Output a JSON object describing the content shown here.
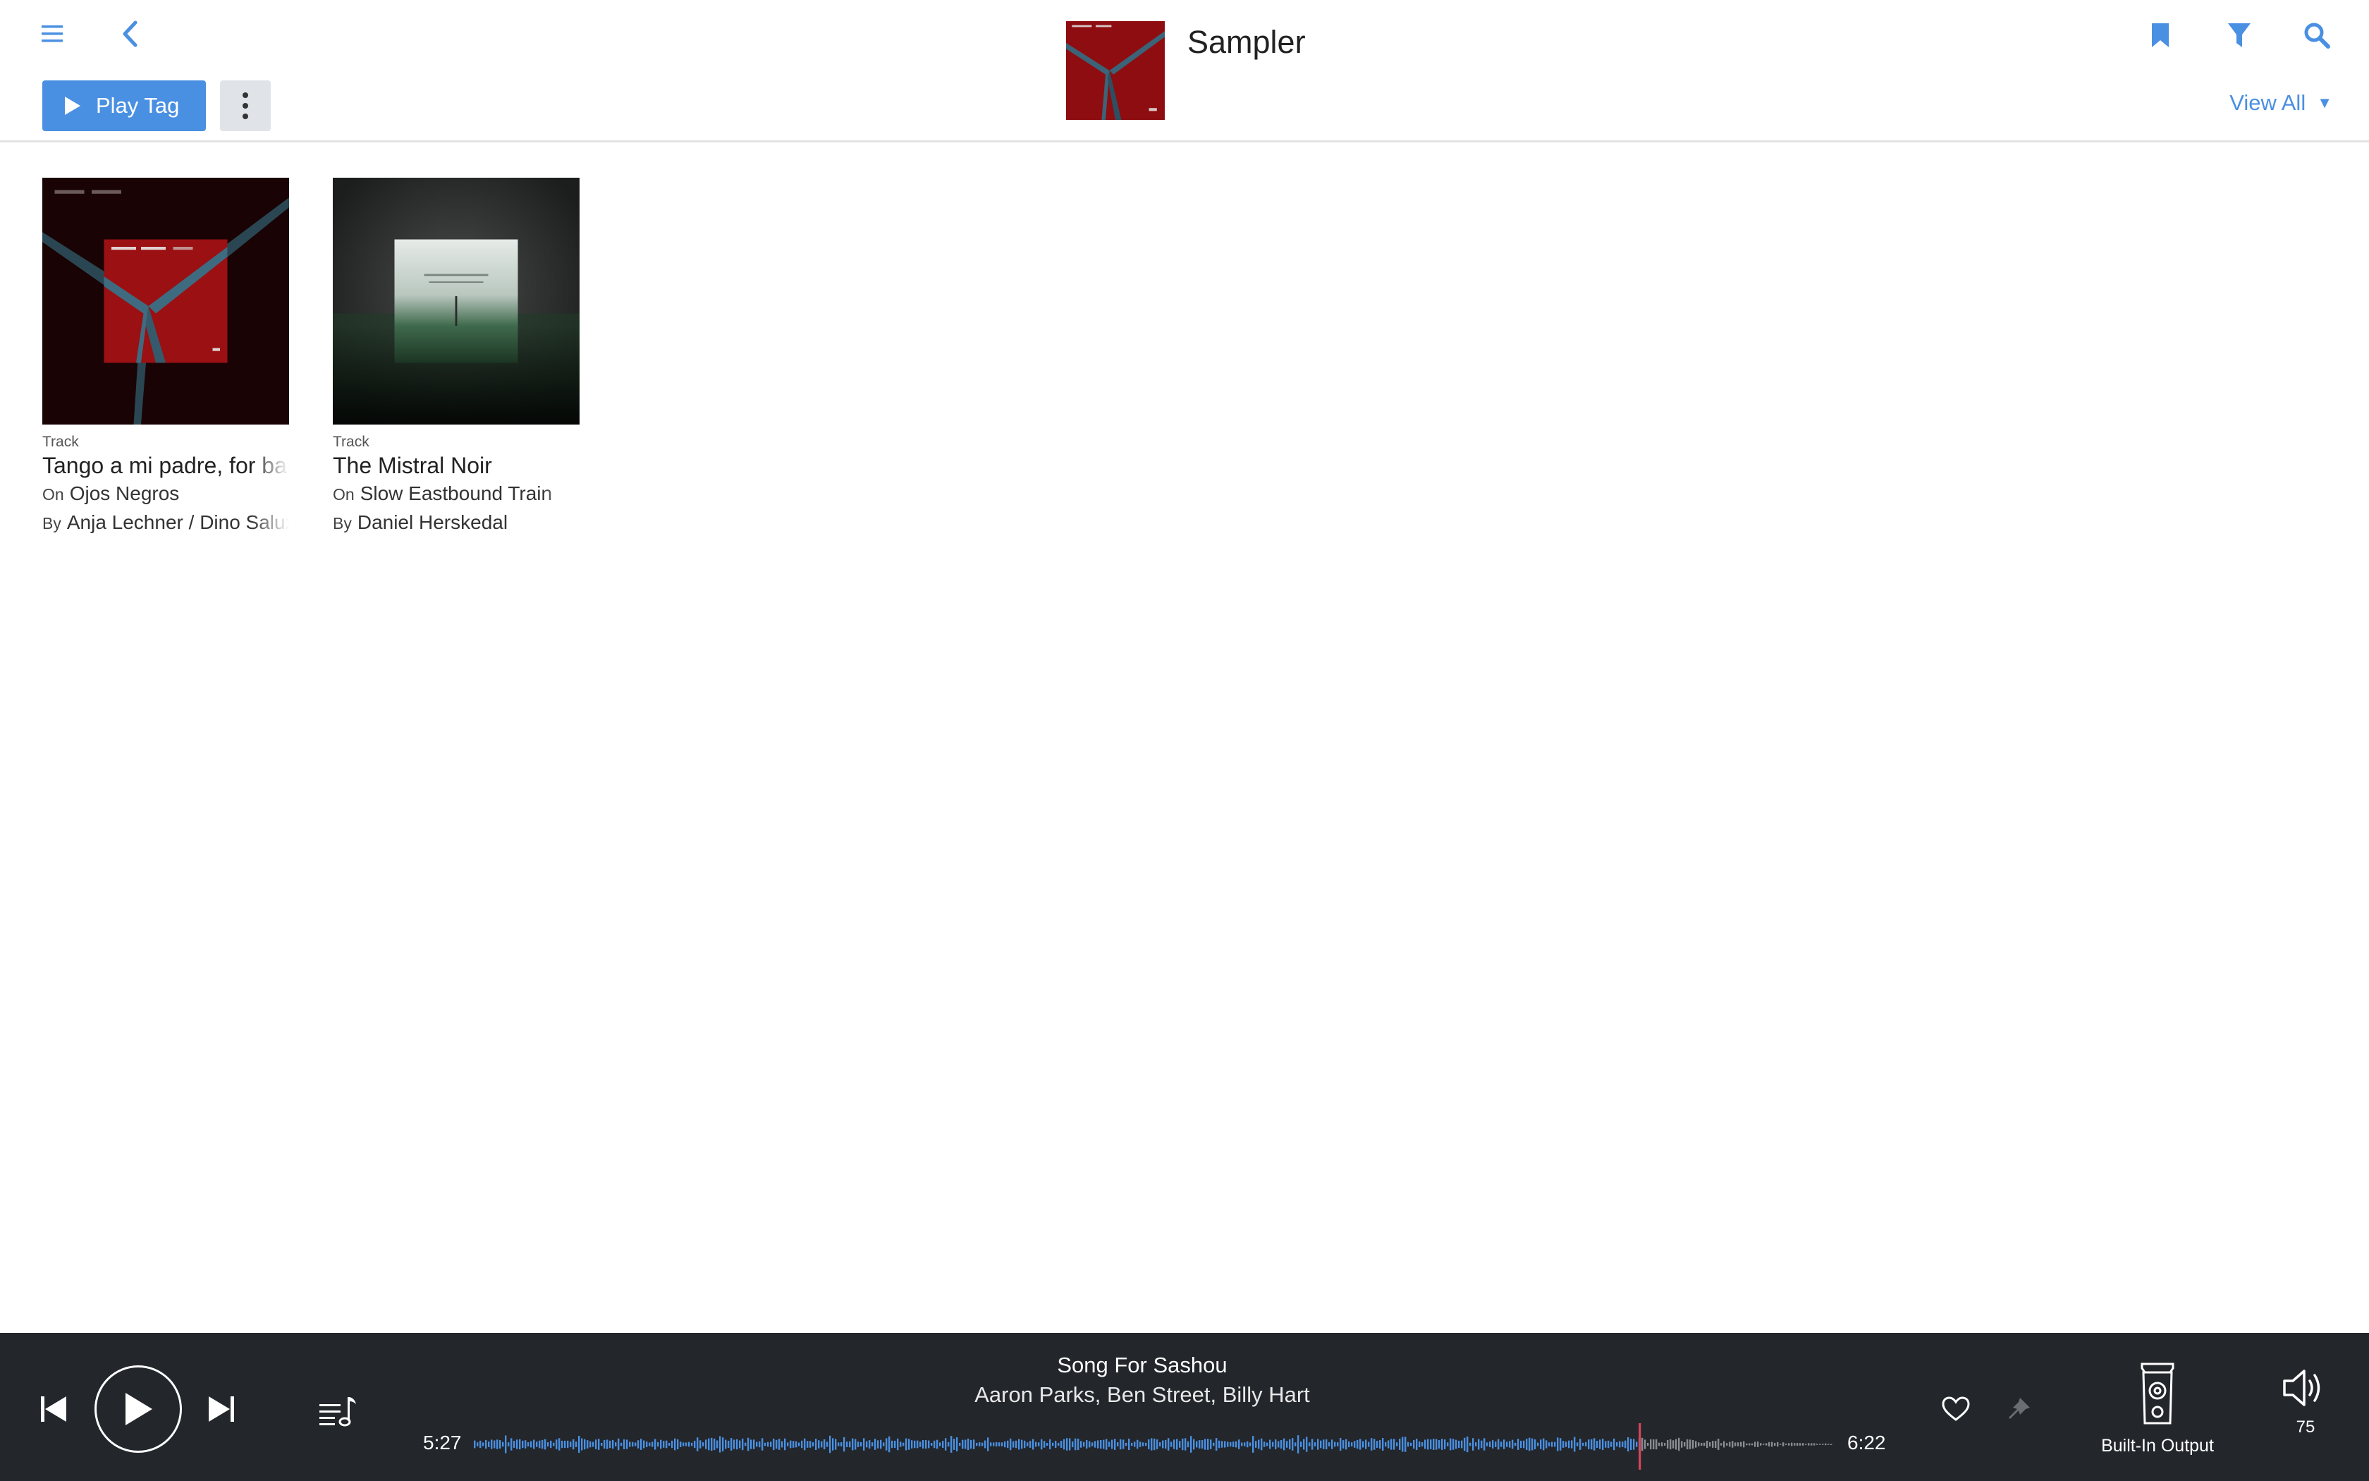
{
  "header": {
    "title": "Sampler",
    "play_tag_label": "Play Tag",
    "view_all_label": "View All",
    "view_all_caret": "▼",
    "icons": {
      "menu": "hamburger-menu-icon",
      "back": "chevron-left-icon",
      "bookmark": "bookmark-icon",
      "filter": "filter-funnel-icon",
      "search": "search-icon",
      "more": "more-vertical-icon"
    }
  },
  "cards": [
    {
      "type": "Track",
      "title": "Tango a mi padre, for bandoneon",
      "on_prefix": "On",
      "album": "Ojos Negros",
      "by_prefix": "By",
      "artist": "Anja Lechner / Dino Saluzzi"
    },
    {
      "type": "Track",
      "title": "The Mistral Noir",
      "on_prefix": "On",
      "album": "Slow Eastbound Train",
      "by_prefix": "By",
      "artist": "Daniel Herskedal"
    }
  ],
  "player": {
    "track_title": "Song For Sashou",
    "track_artist": "Aaron Parks, Ben Street, Billy Hart",
    "elapsed": "5:27",
    "total": "6:22",
    "progress": 0.857,
    "output_label": "Built-In Output",
    "volume": "75",
    "icons": {
      "prev": "skip-previous-icon",
      "play": "play-icon",
      "next": "skip-next-icon",
      "queue": "queue-music-icon",
      "love": "heart-icon",
      "ban": "ban-pin-icon",
      "output": "speaker-device-icon",
      "volume": "volume-icon"
    }
  },
  "colors": {
    "accent": "#4a90e2",
    "player_bg": "#23262b",
    "waveform_played": "#4a90e2",
    "waveform_remaining": "#8a8d92",
    "playhead": "#e0485a"
  }
}
